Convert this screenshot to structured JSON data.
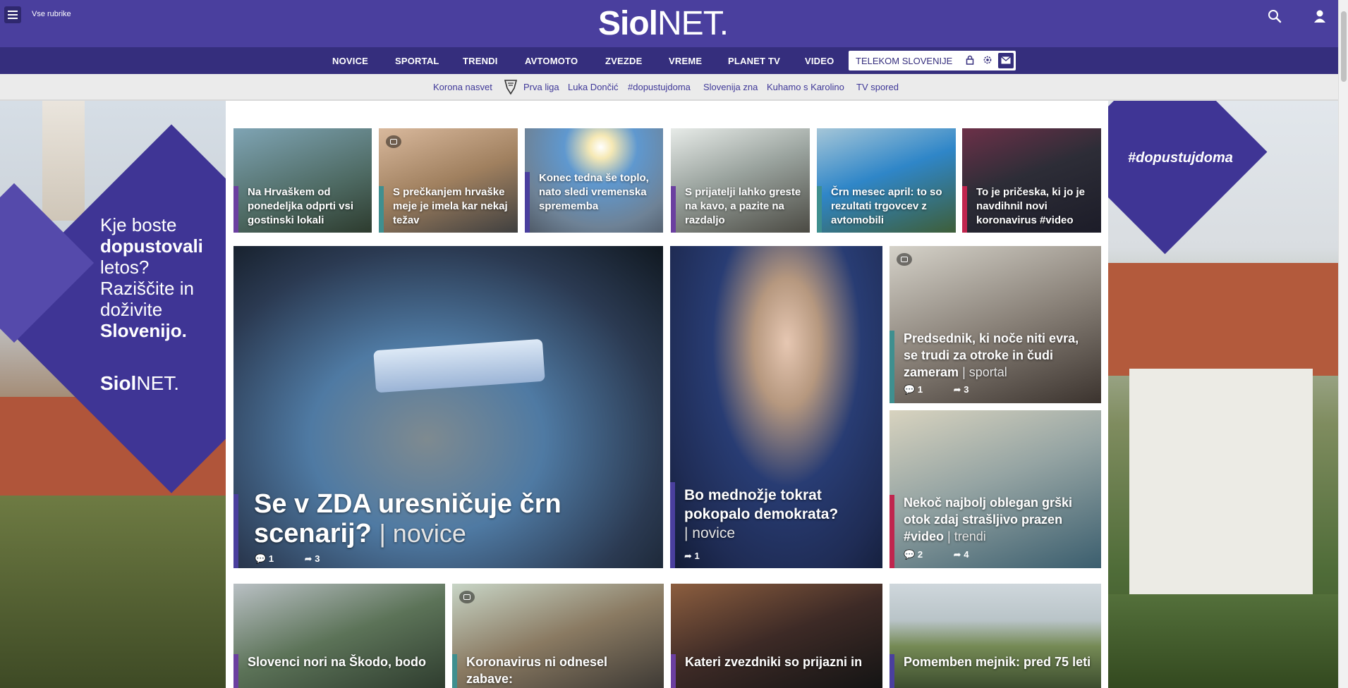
{
  "header": {
    "menu_label": "Vse rubrike",
    "logo_bold": "Siol",
    "logo_light": "NET."
  },
  "nav": {
    "items": [
      "NOVICE",
      "SPORTAL",
      "TRENDI",
      "AVTOMOTO",
      "ZVEZDE",
      "VREME",
      "PLANET TV",
      "VIDEO"
    ],
    "telekom": "TELEKOM SLOVENIJE"
  },
  "quick_links": [
    "Korona nasvet",
    "Prva liga",
    "Luka Dončić",
    "#dopustujdoma",
    "Slovenija zna",
    "Kuhamo s Karolino",
    "TV spored"
  ],
  "ad_left": {
    "line1": "Kje boste",
    "line2": "dopustovali",
    "line3": "letos?",
    "line4": "Raziščite in",
    "line5": "doživite",
    "line6": "Slovenijo.",
    "logo_bold": "Siol",
    "logo_light": "NET."
  },
  "ad_right": {
    "tag": "#dopustujdoma"
  },
  "top_row": [
    {
      "title": "Na Hrvaškem od ponedeljka odprti vsi gostinski lokali",
      "bar_color": "#6b3fa0"
    },
    {
      "title": "S prečkanjem hrvaške meje je imela kar nekaj težav",
      "bar_color": "#3f8f8f"
    },
    {
      "title": "Konec tedna še toplo, nato sledi vremenska sprememba",
      "bar_color": "#4a3f9e"
    },
    {
      "title": "S prijatelji lahko greste na kavo, a pazite na razdaljo",
      "bar_color": "#6b3fa0"
    },
    {
      "title": "Črn mesec april: to so rezultati trgovcev z avtomobili",
      "bar_color": "#3f8f8f"
    },
    {
      "title": "To je pričeska, ki jo je navdihnil novi koronavirus #video",
      "bar_color": "#c0254e"
    }
  ],
  "featured": {
    "title1": "Se v ZDA uresničuje črn",
    "title2": "scenarij?",
    "rubric": "novice",
    "comments": "1",
    "shares": "3",
    "bar_color": "#4a3f9e"
  },
  "biden": {
    "title": "Bo mednožje tokrat pokopalo demokrata?",
    "rubric": "novice",
    "shares": "1",
    "bar_color": "#4a3f9e"
  },
  "side_cards": [
    {
      "title": "Predsednik, ki noče niti evra, se trudi za otroke in čudi zameram",
      "rubric": "sportal",
      "comments": "1",
      "shares": "3",
      "bar_color": "#3f8f8f"
    },
    {
      "title": "Nekoč najbolj oblegan grški otok zdaj strašljivo prazen #video",
      "rubric": "trendi",
      "comments": "2",
      "shares": "4",
      "bar_color": "#c0254e"
    }
  ],
  "bottom_row": [
    {
      "title": "Slovenci nori na Škodo, bodo",
      "bar_color": "#6b3fa0"
    },
    {
      "title": "Koronavirus ni odnesel zabave:",
      "bar_color": "#3f8f8f"
    },
    {
      "title": "Kateri zvezdniki so prijazni in",
      "bar_color": "#6b3fa0"
    },
    {
      "title": "Pomemben mejnik: pred 75 leti",
      "bar_color": "#4a3f9e"
    }
  ]
}
